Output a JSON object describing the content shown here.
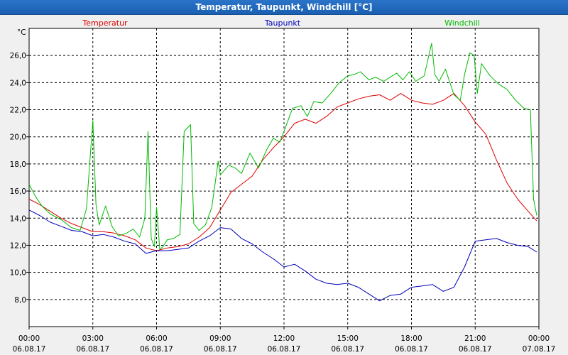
{
  "window": {
    "title": "Temperatur, Taupunkt, Windchill [°C]"
  },
  "chart_data": {
    "type": "line",
    "title": "Temperatur, Taupunkt, Windchill [°C]",
    "ylabel": "°C",
    "ylim": [
      6.0,
      28.0
    ],
    "yticks": [
      "8,0",
      "10,0",
      "12,0",
      "14,0",
      "16,0",
      "18,0",
      "20,0",
      "22,0",
      "24,0",
      "26,0"
    ],
    "xlim": [
      0,
      24
    ],
    "xticks": [
      {
        "time": "00:00",
        "date": "06.08.17"
      },
      {
        "time": "03:00",
        "date": "06.08.17"
      },
      {
        "time": "06:00",
        "date": "06.08.17"
      },
      {
        "time": "09:00",
        "date": "06.08.17"
      },
      {
        "time": "12:00",
        "date": "06.08.17"
      },
      {
        "time": "15:00",
        "date": "06.08.17"
      },
      {
        "time": "18:00",
        "date": "06.08.17"
      },
      {
        "time": "21:00",
        "date": "06.08.17"
      },
      {
        "time": "00:00",
        "date": "07.08.17"
      }
    ],
    "grid": true,
    "legend_placement": "top",
    "series": [
      {
        "name": "Temperatur",
        "color": "#dd0000",
        "x": [
          0,
          0.5,
          1,
          1.5,
          2,
          2.5,
          3,
          3.5,
          4,
          4.5,
          5,
          5.5,
          6,
          6.5,
          7,
          7.5,
          8,
          8.5,
          9,
          9.5,
          10,
          10.5,
          11,
          11.5,
          12,
          12.5,
          13,
          13.5,
          14,
          14.5,
          15,
          15.5,
          16,
          16.5,
          17,
          17.5,
          18,
          18.5,
          19,
          19.5,
          20,
          20.5,
          21,
          21.5,
          22,
          22.5,
          23,
          23.5,
          23.9
        ],
        "y": [
          15.4,
          15.0,
          14.5,
          14.0,
          13.6,
          13.3,
          13.0,
          13.0,
          12.9,
          12.7,
          12.4,
          11.8,
          11.6,
          11.8,
          11.9,
          12.1,
          12.6,
          13.3,
          14.6,
          15.9,
          16.5,
          17.1,
          18.3,
          19.2,
          20.0,
          21.0,
          21.3,
          21.0,
          21.5,
          22.2,
          22.5,
          22.8,
          23.0,
          23.1,
          22.7,
          23.2,
          22.7,
          22.5,
          22.4,
          22.7,
          23.2,
          22.3,
          21.1,
          20.2,
          18.3,
          16.6,
          15.4,
          14.5,
          13.8
        ]
      },
      {
        "name": "Taupunkt",
        "color": "#0000bb",
        "x": [
          0,
          0.5,
          1,
          1.5,
          2,
          2.5,
          3,
          3.5,
          4,
          4.5,
          5,
          5.5,
          6,
          6.5,
          7,
          7.5,
          8,
          8.5,
          9,
          9.5,
          10,
          10.5,
          11,
          11.5,
          12,
          12.5,
          13,
          13.5,
          14,
          14.5,
          15,
          15.5,
          16,
          16.5,
          17,
          17.5,
          18,
          18.5,
          19,
          19.5,
          20,
          20.5,
          21,
          21.5,
          22,
          22.5,
          23,
          23.5,
          23.9
        ],
        "y": [
          14.6,
          14.2,
          13.7,
          13.4,
          13.1,
          13.0,
          12.7,
          12.8,
          12.6,
          12.3,
          12.1,
          11.4,
          11.6,
          11.6,
          11.7,
          11.8,
          12.3,
          12.7,
          13.3,
          13.2,
          12.5,
          12.1,
          11.5,
          11.0,
          10.4,
          10.6,
          10.1,
          9.5,
          9.2,
          9.1,
          9.2,
          8.9,
          8.4,
          7.9,
          8.3,
          8.4,
          8.9,
          9.0,
          9.1,
          8.6,
          8.9,
          10.4,
          12.3,
          12.4,
          12.5,
          12.2,
          12.0,
          11.9,
          11.5
        ]
      },
      {
        "name": "Windchill",
        "color": "#00bb00",
        "x": [
          0,
          0.3,
          0.6,
          1,
          1.5,
          2,
          2.4,
          2.7,
          2.85,
          3.0,
          3.15,
          3.3,
          3.6,
          3.9,
          4.2,
          4.6,
          4.9,
          5.2,
          5.45,
          5.6,
          5.75,
          5.9,
          6.0,
          6.15,
          6.3,
          6.5,
          6.8,
          7.1,
          7.3,
          7.6,
          7.75,
          8.0,
          8.3,
          8.6,
          8.9,
          9.0,
          9.4,
          9.7,
          10.0,
          10.4,
          10.8,
          11.2,
          11.5,
          11.8,
          12.0,
          12.4,
          12.8,
          13.1,
          13.4,
          13.8,
          14.2,
          14.6,
          15.0,
          15.3,
          15.6,
          16.0,
          16.3,
          16.7,
          17.0,
          17.3,
          17.6,
          17.9,
          18.2,
          18.6,
          18.95,
          19.1,
          19.3,
          19.6,
          20.0,
          20.3,
          20.5,
          20.75,
          20.95,
          21.1,
          21.3,
          21.7,
          22.1,
          22.5,
          22.9,
          23.3,
          23.6,
          23.75,
          23.9
        ],
        "y": [
          16.5,
          15.6,
          14.9,
          14.3,
          13.9,
          13.3,
          13.1,
          14.7,
          18.0,
          21.2,
          15.0,
          13.5,
          14.9,
          13.4,
          12.7,
          12.9,
          13.2,
          12.6,
          14.0,
          20.4,
          12.5,
          11.9,
          14.8,
          11.7,
          11.9,
          12.4,
          12.5,
          12.8,
          20.4,
          20.9,
          13.6,
          13.1,
          13.5,
          14.8,
          18.2,
          17.2,
          17.9,
          17.7,
          17.3,
          18.8,
          17.7,
          19.1,
          19.9,
          19.6,
          20.4,
          22.1,
          22.3,
          21.5,
          22.6,
          22.5,
          23.2,
          24.0,
          24.5,
          24.6,
          24.8,
          24.2,
          24.4,
          24.1,
          24.4,
          24.7,
          24.2,
          24.8,
          24.1,
          24.5,
          26.9,
          24.6,
          24.1,
          25.0,
          23.1,
          22.7,
          24.6,
          26.2,
          26.0,
          23.2,
          25.4,
          24.5,
          23.9,
          23.5,
          22.7,
          22.1,
          22.0,
          15.4,
          14.2
        ]
      }
    ]
  }
}
